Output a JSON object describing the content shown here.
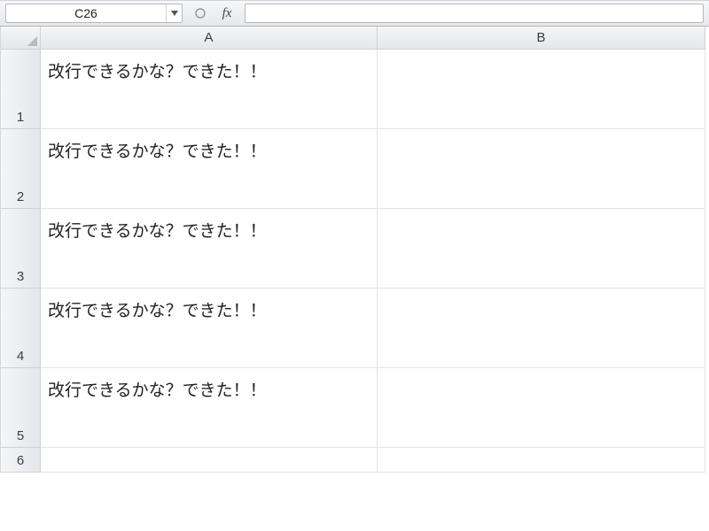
{
  "formula_bar": {
    "name_box": "C26",
    "fx_label": "fx",
    "formula_value": ""
  },
  "columns": [
    "A",
    "B"
  ],
  "rows": [
    {
      "num": "1",
      "A": "改行できるかな？できた！！",
      "B": "",
      "tall": true
    },
    {
      "num": "2",
      "A": "改行できるかな？できた！！",
      "B": "",
      "tall": true
    },
    {
      "num": "3",
      "A": "改行できるかな？できた！！",
      "B": "",
      "tall": true
    },
    {
      "num": "4",
      "A": "改行できるかな？できた！！",
      "B": "",
      "tall": true
    },
    {
      "num": "5",
      "A": "改行できるかな？できた！！",
      "B": "",
      "tall": true
    },
    {
      "num": "6",
      "A": "",
      "B": "",
      "tall": false
    }
  ]
}
